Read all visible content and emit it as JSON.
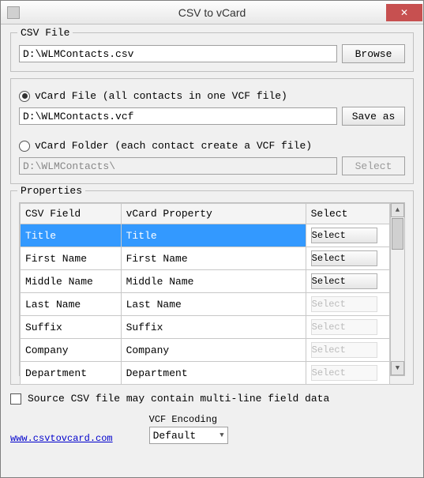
{
  "title": "CSV to vCard",
  "csv": {
    "label": "CSV File",
    "path": "D:\\WLMContacts.csv",
    "browse": "Browse"
  },
  "output": {
    "vcard_file_label": "vCard File (all contacts in one VCF file)",
    "vcard_file_path": "D:\\WLMContacts.vcf",
    "save_as": "Save as",
    "vcard_folder_label": "vCard Folder (each contact create a VCF file)",
    "vcard_folder_path": "D:\\WLMContacts\\",
    "select": "Select",
    "selected_mode": "file"
  },
  "properties": {
    "label": "Properties",
    "headers": [
      "CSV Field",
      "vCard Property",
      "Select"
    ],
    "rows": [
      {
        "csv": "Title",
        "vcard": "Title",
        "btn": "Select",
        "selected": true,
        "faded": false
      },
      {
        "csv": "First Name",
        "vcard": "First Name",
        "btn": "Select",
        "selected": false,
        "faded": false
      },
      {
        "csv": "Middle Name",
        "vcard": "Middle Name",
        "btn": "Select",
        "selected": false,
        "faded": false
      },
      {
        "csv": "Last Name",
        "vcard": "Last Name",
        "btn": "Select",
        "selected": false,
        "faded": true
      },
      {
        "csv": "Suffix",
        "vcard": "Suffix",
        "btn": "Select",
        "selected": false,
        "faded": true
      },
      {
        "csv": "Company",
        "vcard": "Company",
        "btn": "Select",
        "selected": false,
        "faded": true
      },
      {
        "csv": "Department",
        "vcard": "Department",
        "btn": "Select",
        "selected": false,
        "faded": true
      }
    ]
  },
  "multiline": {
    "label": "Source CSV file may contain multi-line field data",
    "checked": false
  },
  "encoding": {
    "label": "VCF Encoding",
    "value": "Default"
  },
  "link": {
    "text": "www.csvtovcard.com"
  }
}
